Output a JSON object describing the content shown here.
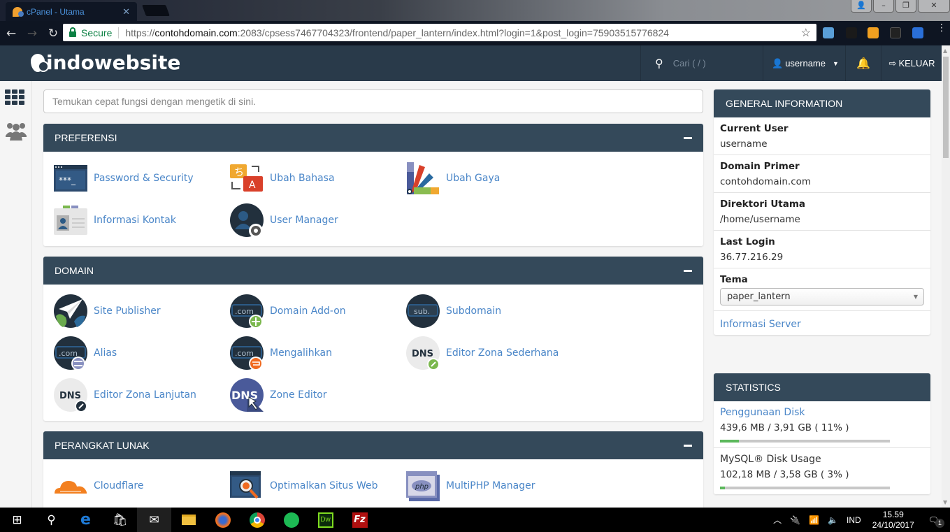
{
  "browser": {
    "tab_title": "cPanel - Utama",
    "secure_label": "Secure",
    "url_scheme": "https://",
    "url_domain": "contohdomain.com",
    "url_rest": ":2083/cpsess7467704323/frontend/paper_lantern/index.html?login=1&post_login=75903515776824"
  },
  "header": {
    "logo_text": "indowebsite",
    "search_placeholder": "Cari ( / )",
    "username": "username",
    "logout_label": "KELUAR"
  },
  "main_search": {
    "placeholder": "Temukan cepat fungsi dengan mengetik di sini."
  },
  "sections": [
    {
      "title": "PREFERENSI",
      "items": [
        {
          "label": "Password & Security",
          "icon": "password-icon"
        },
        {
          "label": "Ubah Bahasa",
          "icon": "language-icon"
        },
        {
          "label": "Ubah Gaya",
          "icon": "style-palette-icon"
        },
        {
          "label": "Informasi Kontak",
          "icon": "contact-card-icon"
        },
        {
          "label": "User Manager",
          "icon": "user-manager-icon"
        }
      ]
    },
    {
      "title": "DOMAIN",
      "items": [
        {
          "label": "Site Publisher",
          "icon": "site-publisher-icon"
        },
        {
          "label": "Domain Add-on",
          "icon": "addon-domain-icon"
        },
        {
          "label": "Subdomain",
          "icon": "subdomain-icon"
        },
        {
          "label": "Alias",
          "icon": "alias-icon"
        },
        {
          "label": "Mengalihkan",
          "icon": "redirect-icon"
        },
        {
          "label": "Editor Zona Sederhana",
          "icon": "simple-zone-editor-icon"
        },
        {
          "label": "Editor Zona Lanjutan",
          "icon": "advanced-zone-editor-icon"
        },
        {
          "label": "Zone Editor",
          "icon": "zone-editor-icon"
        }
      ]
    },
    {
      "title": "PERANGKAT LUNAK",
      "items": [
        {
          "label": "Cloudflare",
          "icon": "cloudflare-icon"
        },
        {
          "label": "Optimalkan Situs Web",
          "icon": "optimize-website-icon"
        },
        {
          "label": "MultiPHP Manager",
          "icon": "multiphp-icon"
        }
      ]
    }
  ],
  "general_info": {
    "title": "GENERAL INFORMATION",
    "rows": [
      {
        "key": "Current User",
        "value": "username"
      },
      {
        "key": "Domain Primer",
        "value": "contohdomain.com"
      },
      {
        "key": "Direktori Utama",
        "value": "/home/username"
      },
      {
        "key": "Last Login",
        "value": "36.77.216.29"
      }
    ],
    "theme_label": "Tema",
    "theme_value": "paper_lantern",
    "server_info_link": "Informasi Server"
  },
  "statistics": {
    "title": "STATISTICS",
    "rows": [
      {
        "label": "Penggunaan Disk",
        "value": "439,6 MB / 3,91 GB ( 11% )",
        "percent": 11,
        "is_link": true
      },
      {
        "label": "MySQL® Disk Usage",
        "value": "102,18 MB / 3,58 GB ( 3% )",
        "percent": 3,
        "is_link": false
      }
    ]
  },
  "taskbar": {
    "language": "IND",
    "time": "15.59",
    "date": "24/10/2017",
    "notification_count": "1"
  },
  "colors": {
    "header_bg": "#293a4a",
    "panel_head_bg": "#34495a",
    "link": "#4a86c8",
    "progress_fill": "#5cb85c"
  }
}
